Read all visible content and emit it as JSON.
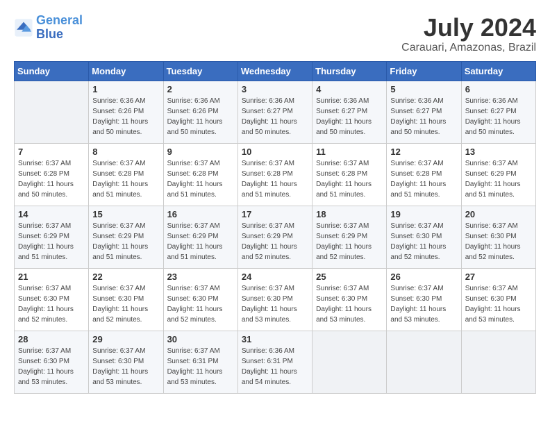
{
  "logo": {
    "line1": "General",
    "line2": "Blue"
  },
  "title": "July 2024",
  "subtitle": "Carauari, Amazonas, Brazil",
  "days_of_week": [
    "Sunday",
    "Monday",
    "Tuesday",
    "Wednesday",
    "Thursday",
    "Friday",
    "Saturday"
  ],
  "weeks": [
    [
      {
        "day": "",
        "sunrise": "",
        "sunset": "",
        "daylight": ""
      },
      {
        "day": "1",
        "sunrise": "Sunrise: 6:36 AM",
        "sunset": "Sunset: 6:26 PM",
        "daylight": "Daylight: 11 hours and 50 minutes."
      },
      {
        "day": "2",
        "sunrise": "Sunrise: 6:36 AM",
        "sunset": "Sunset: 6:26 PM",
        "daylight": "Daylight: 11 hours and 50 minutes."
      },
      {
        "day": "3",
        "sunrise": "Sunrise: 6:36 AM",
        "sunset": "Sunset: 6:27 PM",
        "daylight": "Daylight: 11 hours and 50 minutes."
      },
      {
        "day": "4",
        "sunrise": "Sunrise: 6:36 AM",
        "sunset": "Sunset: 6:27 PM",
        "daylight": "Daylight: 11 hours and 50 minutes."
      },
      {
        "day": "5",
        "sunrise": "Sunrise: 6:36 AM",
        "sunset": "Sunset: 6:27 PM",
        "daylight": "Daylight: 11 hours and 50 minutes."
      },
      {
        "day": "6",
        "sunrise": "Sunrise: 6:36 AM",
        "sunset": "Sunset: 6:27 PM",
        "daylight": "Daylight: 11 hours and 50 minutes."
      }
    ],
    [
      {
        "day": "7",
        "sunrise": "Sunrise: 6:37 AM",
        "sunset": "Sunset: 6:28 PM",
        "daylight": "Daylight: 11 hours and 50 minutes."
      },
      {
        "day": "8",
        "sunrise": "Sunrise: 6:37 AM",
        "sunset": "Sunset: 6:28 PM",
        "daylight": "Daylight: 11 hours and 51 minutes."
      },
      {
        "day": "9",
        "sunrise": "Sunrise: 6:37 AM",
        "sunset": "Sunset: 6:28 PM",
        "daylight": "Daylight: 11 hours and 51 minutes."
      },
      {
        "day": "10",
        "sunrise": "Sunrise: 6:37 AM",
        "sunset": "Sunset: 6:28 PM",
        "daylight": "Daylight: 11 hours and 51 minutes."
      },
      {
        "day": "11",
        "sunrise": "Sunrise: 6:37 AM",
        "sunset": "Sunset: 6:28 PM",
        "daylight": "Daylight: 11 hours and 51 minutes."
      },
      {
        "day": "12",
        "sunrise": "Sunrise: 6:37 AM",
        "sunset": "Sunset: 6:28 PM",
        "daylight": "Daylight: 11 hours and 51 minutes."
      },
      {
        "day": "13",
        "sunrise": "Sunrise: 6:37 AM",
        "sunset": "Sunset: 6:29 PM",
        "daylight": "Daylight: 11 hours and 51 minutes."
      }
    ],
    [
      {
        "day": "14",
        "sunrise": "Sunrise: 6:37 AM",
        "sunset": "Sunset: 6:29 PM",
        "daylight": "Daylight: 11 hours and 51 minutes."
      },
      {
        "day": "15",
        "sunrise": "Sunrise: 6:37 AM",
        "sunset": "Sunset: 6:29 PM",
        "daylight": "Daylight: 11 hours and 51 minutes."
      },
      {
        "day": "16",
        "sunrise": "Sunrise: 6:37 AM",
        "sunset": "Sunset: 6:29 PM",
        "daylight": "Daylight: 11 hours and 51 minutes."
      },
      {
        "day": "17",
        "sunrise": "Sunrise: 6:37 AM",
        "sunset": "Sunset: 6:29 PM",
        "daylight": "Daylight: 11 hours and 52 minutes."
      },
      {
        "day": "18",
        "sunrise": "Sunrise: 6:37 AM",
        "sunset": "Sunset: 6:29 PM",
        "daylight": "Daylight: 11 hours and 52 minutes."
      },
      {
        "day": "19",
        "sunrise": "Sunrise: 6:37 AM",
        "sunset": "Sunset: 6:30 PM",
        "daylight": "Daylight: 11 hours and 52 minutes."
      },
      {
        "day": "20",
        "sunrise": "Sunrise: 6:37 AM",
        "sunset": "Sunset: 6:30 PM",
        "daylight": "Daylight: 11 hours and 52 minutes."
      }
    ],
    [
      {
        "day": "21",
        "sunrise": "Sunrise: 6:37 AM",
        "sunset": "Sunset: 6:30 PM",
        "daylight": "Daylight: 11 hours and 52 minutes."
      },
      {
        "day": "22",
        "sunrise": "Sunrise: 6:37 AM",
        "sunset": "Sunset: 6:30 PM",
        "daylight": "Daylight: 11 hours and 52 minutes."
      },
      {
        "day": "23",
        "sunrise": "Sunrise: 6:37 AM",
        "sunset": "Sunset: 6:30 PM",
        "daylight": "Daylight: 11 hours and 52 minutes."
      },
      {
        "day": "24",
        "sunrise": "Sunrise: 6:37 AM",
        "sunset": "Sunset: 6:30 PM",
        "daylight": "Daylight: 11 hours and 53 minutes."
      },
      {
        "day": "25",
        "sunrise": "Sunrise: 6:37 AM",
        "sunset": "Sunset: 6:30 PM",
        "daylight": "Daylight: 11 hours and 53 minutes."
      },
      {
        "day": "26",
        "sunrise": "Sunrise: 6:37 AM",
        "sunset": "Sunset: 6:30 PM",
        "daylight": "Daylight: 11 hours and 53 minutes."
      },
      {
        "day": "27",
        "sunrise": "Sunrise: 6:37 AM",
        "sunset": "Sunset: 6:30 PM",
        "daylight": "Daylight: 11 hours and 53 minutes."
      }
    ],
    [
      {
        "day": "28",
        "sunrise": "Sunrise: 6:37 AM",
        "sunset": "Sunset: 6:30 PM",
        "daylight": "Daylight: 11 hours and 53 minutes."
      },
      {
        "day": "29",
        "sunrise": "Sunrise: 6:37 AM",
        "sunset": "Sunset: 6:30 PM",
        "daylight": "Daylight: 11 hours and 53 minutes."
      },
      {
        "day": "30",
        "sunrise": "Sunrise: 6:37 AM",
        "sunset": "Sunset: 6:31 PM",
        "daylight": "Daylight: 11 hours and 53 minutes."
      },
      {
        "day": "31",
        "sunrise": "Sunrise: 6:36 AM",
        "sunset": "Sunset: 6:31 PM",
        "daylight": "Daylight: 11 hours and 54 minutes."
      },
      {
        "day": "",
        "sunrise": "",
        "sunset": "",
        "daylight": ""
      },
      {
        "day": "",
        "sunrise": "",
        "sunset": "",
        "daylight": ""
      },
      {
        "day": "",
        "sunrise": "",
        "sunset": "",
        "daylight": ""
      }
    ]
  ]
}
